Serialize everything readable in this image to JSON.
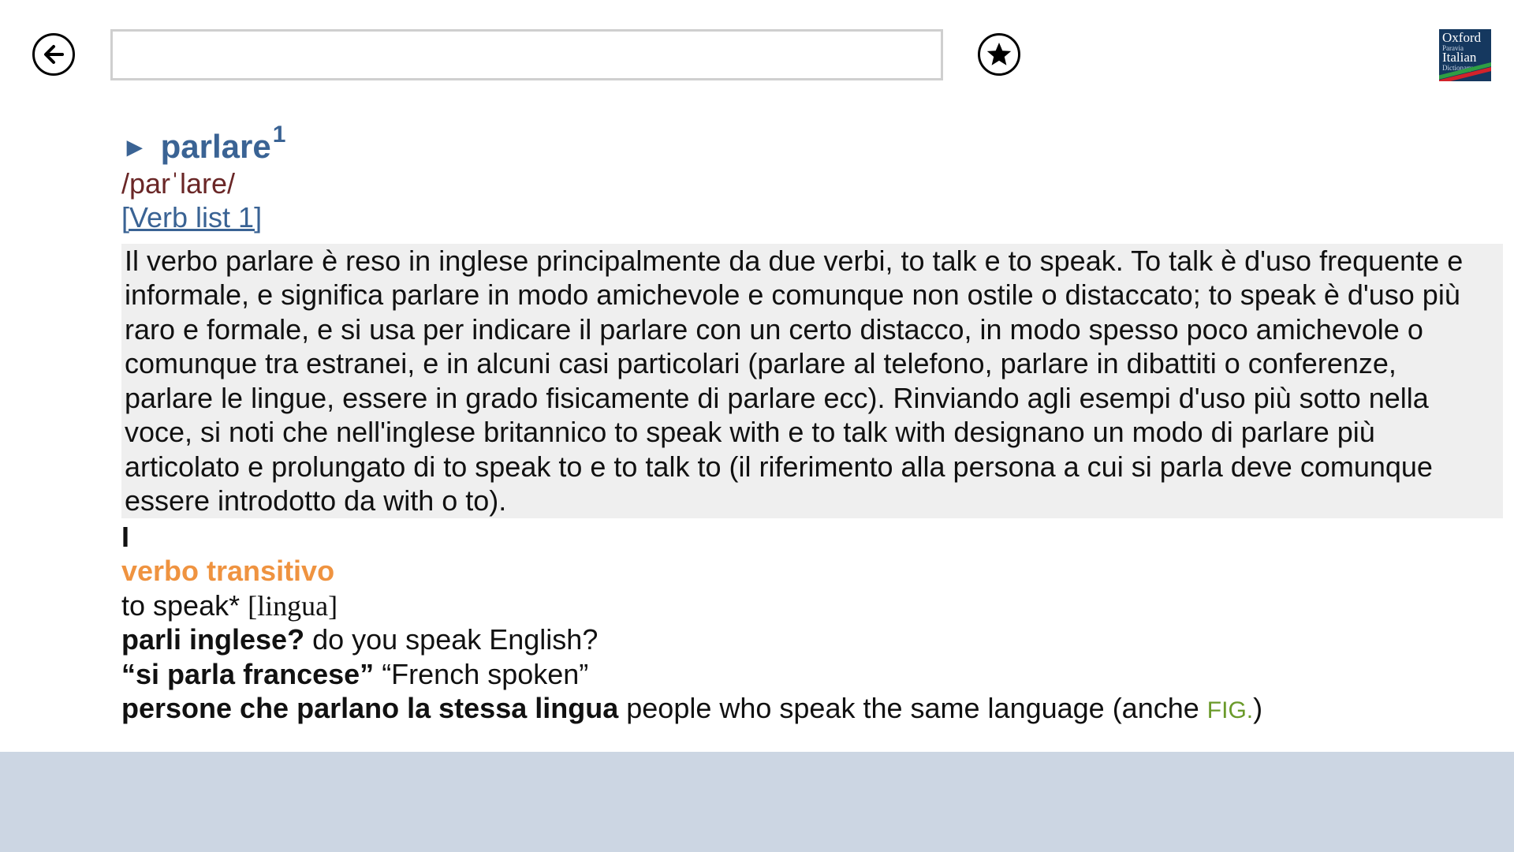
{
  "app": {
    "logo_line1": "Oxford",
    "logo_line2": "Paravia",
    "logo_line3": "Italian",
    "logo_line4": "Dictionary"
  },
  "search": {
    "value": "",
    "placeholder": ""
  },
  "icons": {
    "back": "back-arrow-icon",
    "favorite": "star-icon"
  },
  "colors": {
    "headword": "#3a6394",
    "pronunciation": "#6a2727",
    "part_of_speech": "#ef9340",
    "register_label": "#6a9a2a",
    "usage_background": "#efefef",
    "footer_background": "#ccd6e3"
  },
  "entry": {
    "arrow": "►",
    "headword": "parlare",
    "homograph": "1",
    "pronunciation": "/parˈlare/",
    "verb_list_link": "[Verb list 1]",
    "usage_note": "Il verbo parlare è reso in inglese principalmente da due verbi, to talk e to speak. To talk è d'uso frequente e informale, e significa parlare in modo amichevole e comunque non ostile o distaccato; to speak è d'uso più raro e formale, e si usa per indicare il parlare con un certo distacco, in modo spesso poco amichevole o comunque tra estranei, e in alcuni casi particolari (parlare al telefono, parlare in dibattiti o conferenze, parlare le lingue, essere in grado fisicamente di parlare ecc). Rinviando agli esempi d'uso più sotto nella voce, si noti che nell'inglese britannico to speak with e to talk with designano un modo di parlare più articolato e prolungato di to speak to e to talk to (il riferimento alla persona a cui si parla deve comunque essere introdotto da with o to).",
    "sense_number": "I",
    "part_of_speech": "verbo transitivo",
    "translation": "to speak*",
    "collocate": "[lingua]",
    "examples": [
      {
        "source": "parli inglese?",
        "target": "do you speak English?"
      },
      {
        "source": "“si parla francese”",
        "target": "“French spoken”"
      },
      {
        "source": "persone che parlano la stessa lingua",
        "target": "people who speak the same language (anche",
        "label": "FIG.",
        "after": ")"
      }
    ]
  }
}
